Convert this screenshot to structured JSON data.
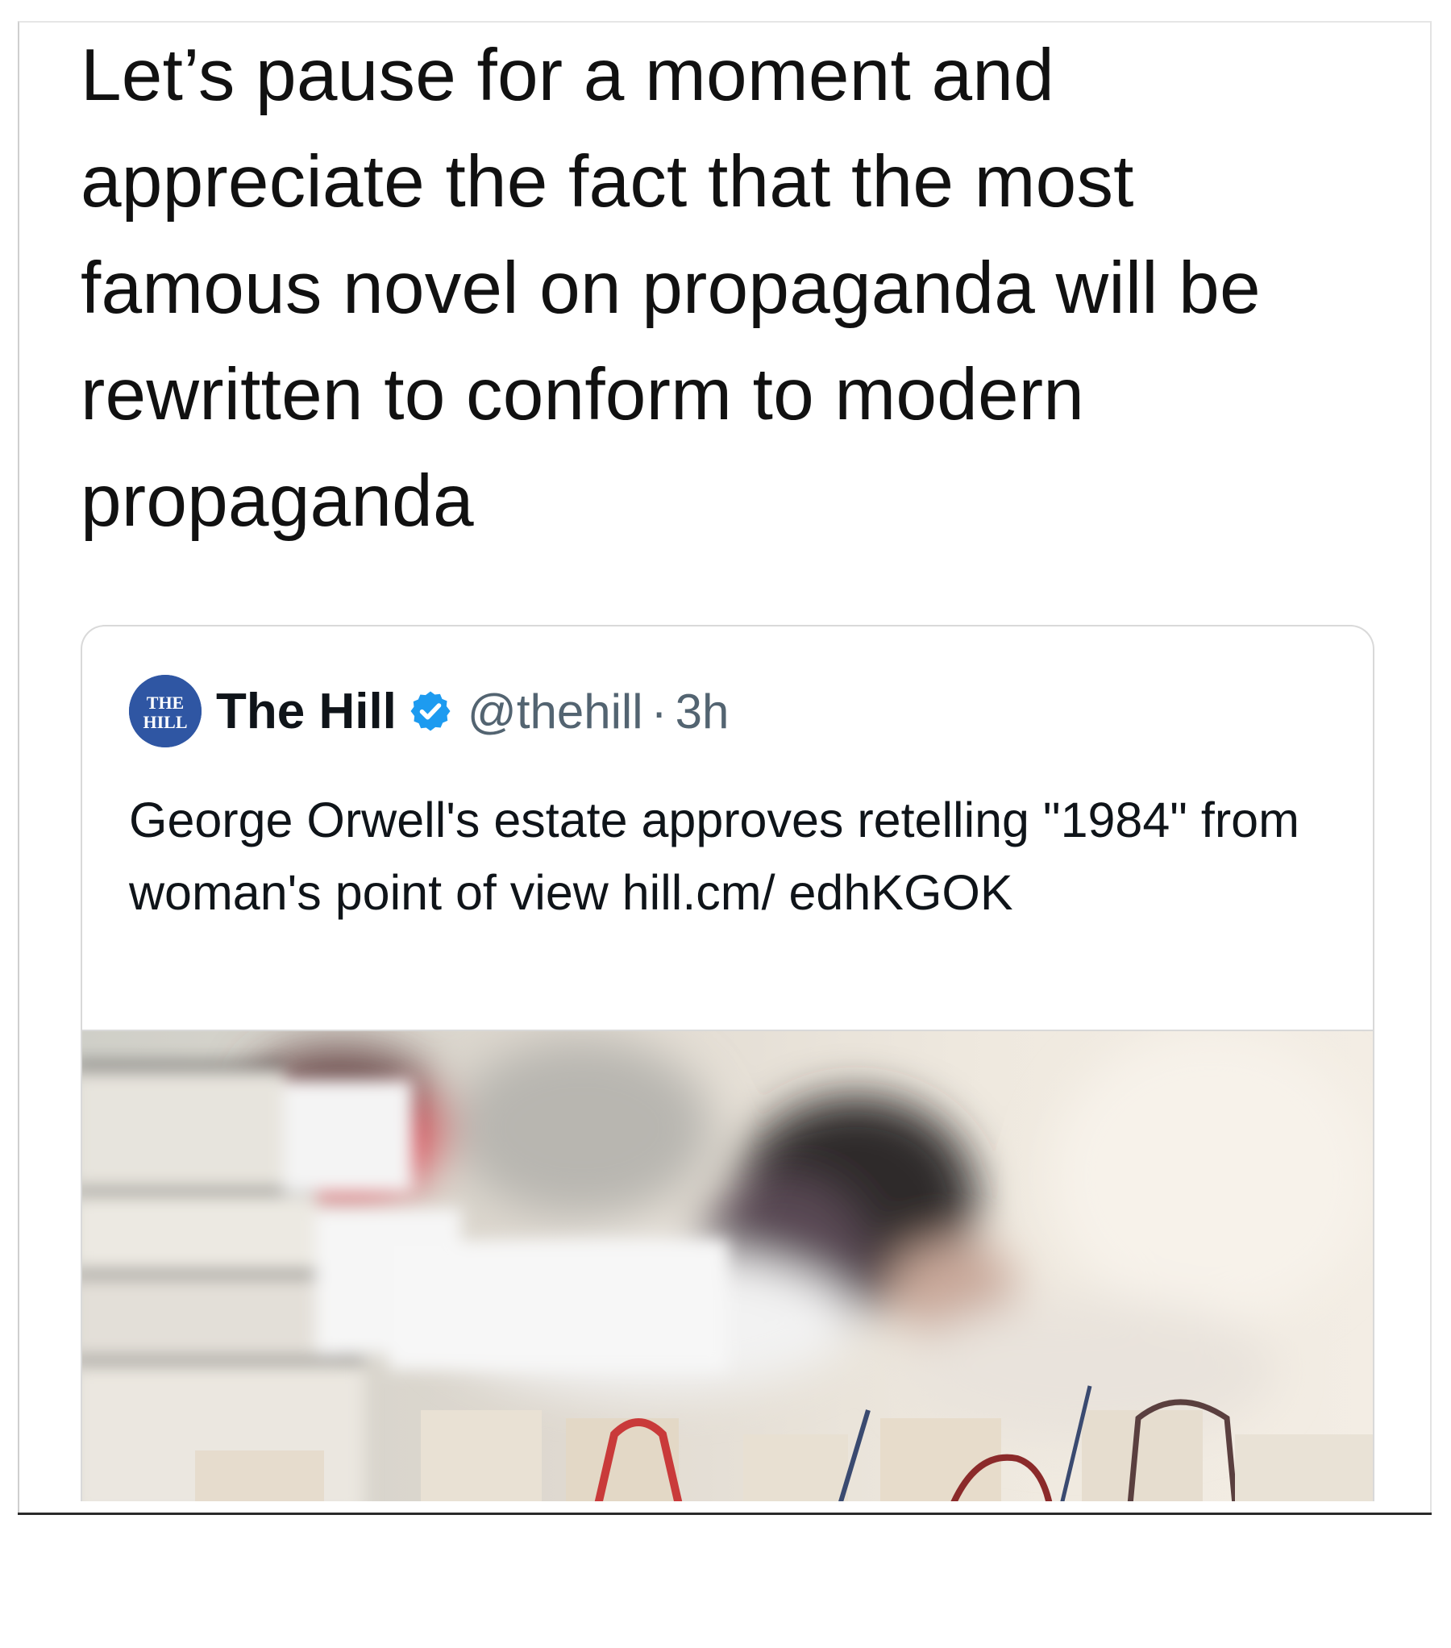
{
  "post": {
    "text": "Let’s pause for a moment and appreciate the fact that the most famous novel on propaganda will be rewritten to conform to modern propaganda"
  },
  "quoted_tweet": {
    "display_name": "The Hill",
    "handle": "@thehill",
    "separator": "·",
    "time": "3h",
    "avatar_text": "THE HILL",
    "text": "George Orwell's estate approves retelling \"1984\" from woman's point of view hill.cm/ edhKGOK",
    "verified": true,
    "media": {
      "kind": "blurred photo of stacked books"
    }
  },
  "colors": {
    "text": "#111111",
    "secondary_text": "#536471",
    "card_border": "#d9d9d9",
    "verified_badge": "#1d9bf0",
    "avatar_bg": "#2f56a3"
  }
}
